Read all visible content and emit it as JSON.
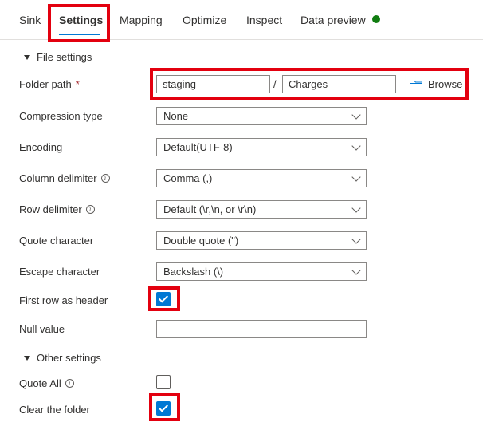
{
  "tabs": [
    {
      "label": "Sink"
    },
    {
      "label": "Settings"
    },
    {
      "label": "Mapping"
    },
    {
      "label": "Optimize"
    },
    {
      "label": "Inspect"
    },
    {
      "label": "Data preview"
    }
  ],
  "active_tab": "Settings",
  "data_preview_status_color": "#107c10",
  "file_settings": {
    "title": "File settings",
    "folder_path": {
      "label": "Folder path",
      "required_marker": "*",
      "container": "staging",
      "separator": "/",
      "directory": "Charges",
      "browse_label": "Browse",
      "browse_icon": "folder-icon"
    },
    "compression_type": {
      "label": "Compression type",
      "value": "None"
    },
    "encoding": {
      "label": "Encoding",
      "value": "Default(UTF-8)"
    },
    "column_delimiter": {
      "label": "Column delimiter",
      "value": "Comma (,)"
    },
    "row_delimiter": {
      "label": "Row delimiter",
      "value": "Default (\\r,\\n, or \\r\\n)"
    },
    "quote_character": {
      "label": "Quote character",
      "value": "Double quote (\")"
    },
    "escape_character": {
      "label": "Escape character",
      "value": "Backslash (\\)"
    },
    "first_row_as_header": {
      "label": "First row as header",
      "checked": true
    },
    "null_value": {
      "label": "Null value",
      "value": ""
    }
  },
  "other_settings": {
    "title": "Other settings",
    "quote_all": {
      "label": "Quote All",
      "checked": false
    },
    "clear_the_folder": {
      "label": "Clear the folder",
      "checked": true
    }
  },
  "colors": {
    "accent": "#0078d4",
    "highlight_box": "#e3000f"
  }
}
